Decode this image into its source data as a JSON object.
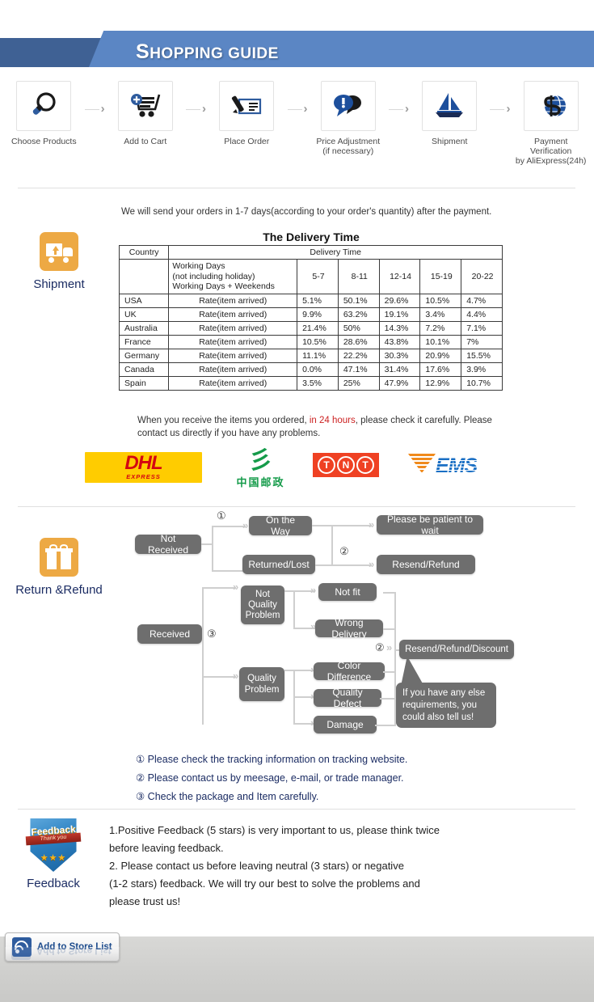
{
  "header": {
    "title_cap": "S",
    "title_rest": "HOPPING GUIDE",
    "bar_color": "#3f6194",
    "accent_color": "#5b86c4"
  },
  "steps": [
    {
      "icon": "magnifier-icon",
      "label": "Choose Products",
      "label2": ""
    },
    {
      "icon": "shopping-cart-plus-icon",
      "label": "Add to Cart",
      "label2": ""
    },
    {
      "icon": "order-form-pen-icon",
      "label": "Place Order",
      "label2": ""
    },
    {
      "icon": "speech-bubble-alert-icon",
      "label": "Price Adjustment",
      "label2": "(if necessary)"
    },
    {
      "icon": "sailboat-icon",
      "label": "Shipment",
      "label2": ""
    },
    {
      "icon": "dollar-globe-icon",
      "label": "Payment Verification",
      "label2": "by AliExpress(24h)"
    }
  ],
  "step_arrow": "›",
  "shipment": {
    "side_label": "Shipment",
    "side_icon": "delivery-truck-icon",
    "side_icon_color": "#eda944",
    "intro": "We will send your orders in 1-7 days(according to your order's quantity) after the payment.",
    "table_title": "The Delivery Time",
    "table": {
      "country_header": "Country",
      "delivery_header": "Delivery Time",
      "days_header_line1": "Working Days",
      "days_header_line2": "(not including holiday)",
      "days_header_line3": "Working Days + Weekends",
      "ranges": [
        "5-7",
        "8-11",
        "12-14",
        "15-19",
        "20-22"
      ],
      "rate_label": "Rate(item arrived)",
      "rows": [
        {
          "country": "USA",
          "rate": "Rate(item arrived)",
          "values": [
            "5.1%",
            "50.1%",
            "29.6%",
            "10.5%",
            "4.7%"
          ]
        },
        {
          "country": "UK",
          "rate": "Rate(item arrived)",
          "values": [
            "9.9%",
            "63.2%",
            "19.1%",
            "3.4%",
            "4.4%"
          ]
        },
        {
          "country": "Australia",
          "rate": "Rate(item arrived)",
          "values": [
            "21.4%",
            "50%",
            "14.3%",
            "7.2%",
            "7.1%"
          ]
        },
        {
          "country": "France",
          "rate": "Rate(item arrived)",
          "values": [
            "10.5%",
            "28.6%",
            "43.8%",
            "10.1%",
            "7%"
          ]
        },
        {
          "country": "Germany",
          "rate": "Rate(item arrived)",
          "values": [
            "11.1%",
            "22.2%",
            "30.3%",
            "20.9%",
            "15.5%"
          ]
        },
        {
          "country": "Canada",
          "rate": "Rate(item arrived)",
          "values": [
            "0.0%",
            "47.1%",
            "31.4%",
            "17.6%",
            "3.9%"
          ]
        },
        {
          "country": "Spain",
          "rate": "Rate(item arrived)",
          "values": [
            "3.5%",
            "25%",
            "47.9%",
            "12.9%",
            "10.7%"
          ]
        }
      ]
    },
    "note_pre": "When you receive the items you ordered, ",
    "note_red": "in 24 hours",
    "note_post": ", please check it carefully. Please contact us directly if you have any problems."
  },
  "carriers": [
    {
      "name": "DHL",
      "sub": "EXPRESS",
      "bg": "#ffcc00",
      "fg": "#d40511"
    },
    {
      "name": "China Post",
      "cn": "中国邮政",
      "mark": "彡",
      "fg": "#159b4a"
    },
    {
      "name": "TNT",
      "letters": [
        "T",
        "N",
        "T"
      ],
      "bg": "#ef4123"
    },
    {
      "name": "EMS",
      "fg": "#1a6fc4",
      "accent": "#f08a1c"
    }
  ],
  "refund": {
    "side_label": "Return &Refund",
    "side_icon": "gift-box-icon",
    "side_icon_color": "#eda944",
    "nodes": {
      "not_received": "Not Received",
      "on_the_way": "On the Way",
      "returned_lost": "Returned/Lost",
      "please_wait": "Please be patient to wait",
      "resend_refund": "Resend/Refund",
      "received": "Received",
      "not_quality_problem": "Not\nQuality\nProblem",
      "not_fit": "Not fit",
      "wrong_delivery": "Wrong Delivery",
      "quality_problem": "Quality\nProblem",
      "color_difference": "Color Difference",
      "quality_defect": "Quality Defect",
      "damage": "Damage",
      "resend_refund_discount": "Resend/Refund/Discount",
      "callout": "If you have any else requirements, you could also tell us!"
    },
    "markers": {
      "one": "①",
      "two": "②",
      "three": "③"
    },
    "notes": [
      "① Please check the tracking information on tracking website.",
      "② Please contact us by meesage, e-mail, or trade manager.",
      "③ Check the package and Item carefully."
    ]
  },
  "feedback": {
    "side_label": "Feedback",
    "side_icon": "feedback-shield-icon",
    "badge_title": "Feedback",
    "badge_sub": "Thank you",
    "badge_stars": "★★★",
    "lines": [
      "1.Positive Feedback (5 stars) is very important to us, please think twice",
      " before leaving feedback.",
      "2. Please contact us before leaving neutral (3 stars) or negative",
      "(1-2 stars) feedback. We will try our best to solve the problems and",
      " please trust us!"
    ]
  },
  "footer": {
    "store_button_label": "Add to Store List",
    "store_icon": "rss-icon"
  }
}
